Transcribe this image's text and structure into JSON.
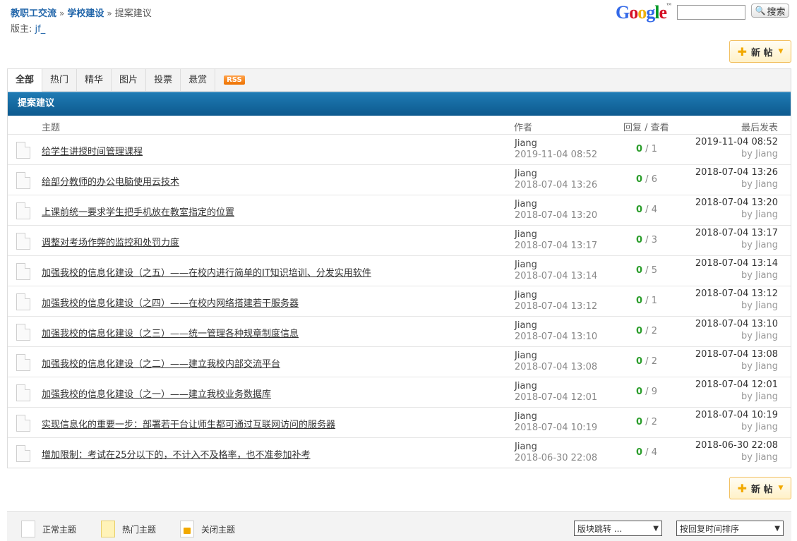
{
  "breadcrumb": {
    "root": "教职工交流",
    "section": "学校建设",
    "current": "提案建议",
    "separator": "»"
  },
  "moderator": {
    "label": "版主:",
    "name": "jf_"
  },
  "search": {
    "logo": "Google",
    "tm": "™",
    "button_label": "搜索"
  },
  "new_post": {
    "label": "新 帖"
  },
  "tabs": [
    {
      "label": "全部",
      "active": true
    },
    {
      "label": "热门"
    },
    {
      "label": "精华"
    },
    {
      "label": "图片"
    },
    {
      "label": "投票"
    },
    {
      "label": "悬赏"
    }
  ],
  "rss_label": "RSS",
  "forum_title": "提案建议",
  "columns": {
    "subject": "主题",
    "author": "作者",
    "stats": "回复 / 查看",
    "last": "最后发表"
  },
  "threads": [
    {
      "title": "给学生讲授时间管理课程",
      "author": "Jiang",
      "date": "2019-11-04 08:52",
      "replies": "0",
      "views": "1",
      "last_date": "2019-11-04 08:52",
      "last_by": "by Jiang"
    },
    {
      "title": "给部分教师的办公电脑使用云技术",
      "author": "Jiang",
      "date": "2018-07-04 13:26",
      "replies": "0",
      "views": "6",
      "last_date": "2018-07-04 13:26",
      "last_by": "by Jiang"
    },
    {
      "title": "上课前统一要求学生把手机放在教室指定的位置",
      "author": "Jiang",
      "date": "2018-07-04 13:20",
      "replies": "0",
      "views": "4",
      "last_date": "2018-07-04 13:20",
      "last_by": "by Jiang"
    },
    {
      "title": "调整对考场作弊的监控和处罚力度",
      "author": "Jiang",
      "date": "2018-07-04 13:17",
      "replies": "0",
      "views": "3",
      "last_date": "2018-07-04 13:17",
      "last_by": "by Jiang"
    },
    {
      "title": "加强我校的信息化建设（之五）——在校内进行简单的IT知识培训、分发实用软件",
      "author": "Jiang",
      "date": "2018-07-04 13:14",
      "replies": "0",
      "views": "5",
      "last_date": "2018-07-04 13:14",
      "last_by": "by Jiang"
    },
    {
      "title": "加强我校的信息化建设（之四）——在校内网络搭建若干服务器",
      "author": "Jiang",
      "date": "2018-07-04 13:12",
      "replies": "0",
      "views": "1",
      "last_date": "2018-07-04 13:12",
      "last_by": "by Jiang"
    },
    {
      "title": "加强我校的信息化建设（之三）——统一管理各种规章制度信息",
      "author": "Jiang",
      "date": "2018-07-04 13:10",
      "replies": "0",
      "views": "2",
      "last_date": "2018-07-04 13:10",
      "last_by": "by Jiang"
    },
    {
      "title": "加强我校的信息化建设（之二）——建立我校内部交流平台",
      "author": "Jiang",
      "date": "2018-07-04 13:08",
      "replies": "0",
      "views": "2",
      "last_date": "2018-07-04 13:08",
      "last_by": "by Jiang"
    },
    {
      "title": "加强我校的信息化建设（之一）——建立我校业务数据库",
      "author": "Jiang",
      "date": "2018-07-04 12:01",
      "replies": "0",
      "views": "9",
      "last_date": "2018-07-04 12:01",
      "last_by": "by Jiang"
    },
    {
      "title": "实现信息化的重要一步：部署若干台让师生都可通过互联网访问的服务器",
      "author": "Jiang",
      "date": "2018-07-04 10:19",
      "replies": "0",
      "views": "2",
      "last_date": "2018-07-04 10:19",
      "last_by": "by Jiang"
    },
    {
      "title": "增加限制：考试在25分以下的，不计入不及格率，也不准参加补考",
      "author": "Jiang",
      "date": "2018-06-30 22:08",
      "replies": "0",
      "views": "4",
      "last_date": "2018-06-30 22:08",
      "last_by": "by Jiang"
    }
  ],
  "legend": {
    "normal": "正常主题",
    "hot": "热门主题",
    "closed": "关闭主题"
  },
  "forum_jump": {
    "selected": "版块跳转 ..."
  },
  "sort": {
    "selected": "按回复时间排序"
  },
  "colors": {
    "accent": "#1f7bb4",
    "reply": "#2a9d2a",
    "link": "#2266aa"
  }
}
